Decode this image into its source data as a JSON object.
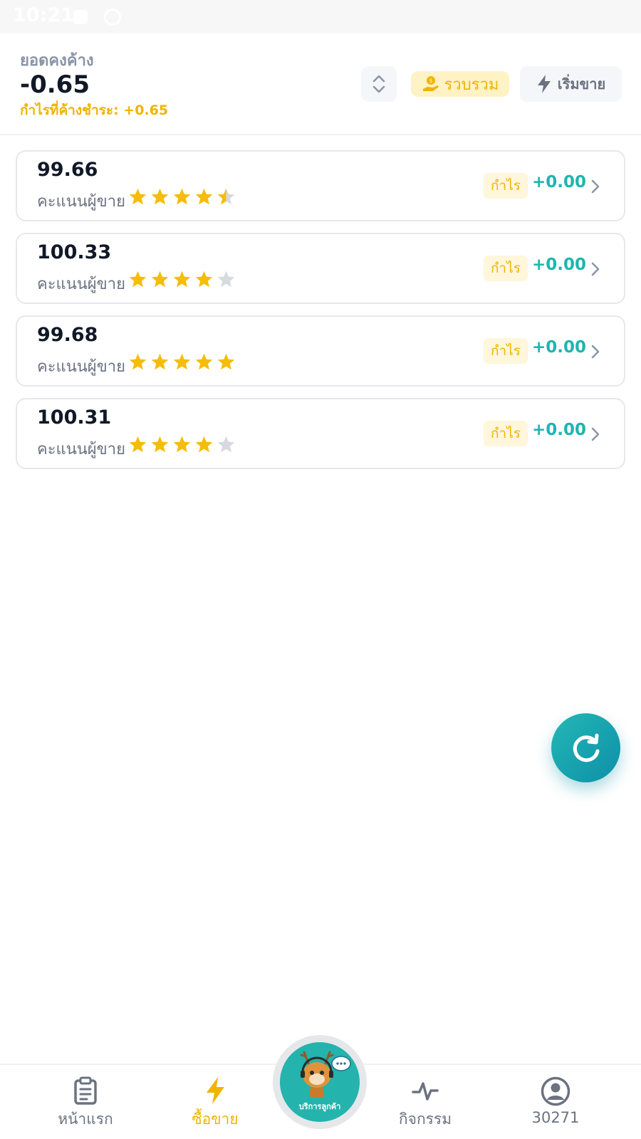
{
  "status_bar": {
    "time": "10:21"
  },
  "header": {
    "balance_label": "ยอดคงค้าง",
    "balance_value": "-0.65",
    "pending_profit": "กำไรที่ค้างชำระ: +0.65",
    "collect_label": "รวบรวม",
    "start_sell_label": "เริ่มขาย",
    "sort_icon": "sort-updown-icon",
    "collect_icon": "money-hand-icon",
    "start_sell_icon": "lightning-icon"
  },
  "orders": [
    {
      "price": "99.66",
      "seller_label": "คะแนนผู้ขาย",
      "rating": 4.5,
      "profit_label": "กำไร",
      "profit_value": "+0.00"
    },
    {
      "price": "100.33",
      "seller_label": "คะแนนผู้ขาย",
      "rating": 4,
      "profit_label": "กำไร",
      "profit_value": "+0.00"
    },
    {
      "price": "99.68",
      "seller_label": "คะแนนผู้ขาย",
      "rating": 5,
      "profit_label": "กำไร",
      "profit_value": "+0.00"
    },
    {
      "price": "100.31",
      "seller_label": "คะแนนผู้ขาย",
      "rating": 4,
      "profit_label": "กำไร",
      "profit_value": "+0.00"
    }
  ],
  "refresh_button": {
    "icon": "refresh-icon"
  },
  "bottom_nav": {
    "items": [
      {
        "label": "หน้าแรก",
        "icon": "clipboard-icon",
        "active": false
      },
      {
        "label": "ซื้อขาย",
        "icon": "lightning-icon",
        "active": true
      },
      {
        "label": "กิจกรรม",
        "icon": "activity-pulse-icon",
        "active": false
      },
      {
        "label": "30271",
        "icon": "user-circle-icon",
        "active": false
      }
    ],
    "support_label": "บริการลูกค้า"
  },
  "colors": {
    "accent_yellow": "#f0b400",
    "accent_teal": "#1fb5b0",
    "star_filled": "#f5bd0a",
    "star_empty": "#d6d9de"
  }
}
